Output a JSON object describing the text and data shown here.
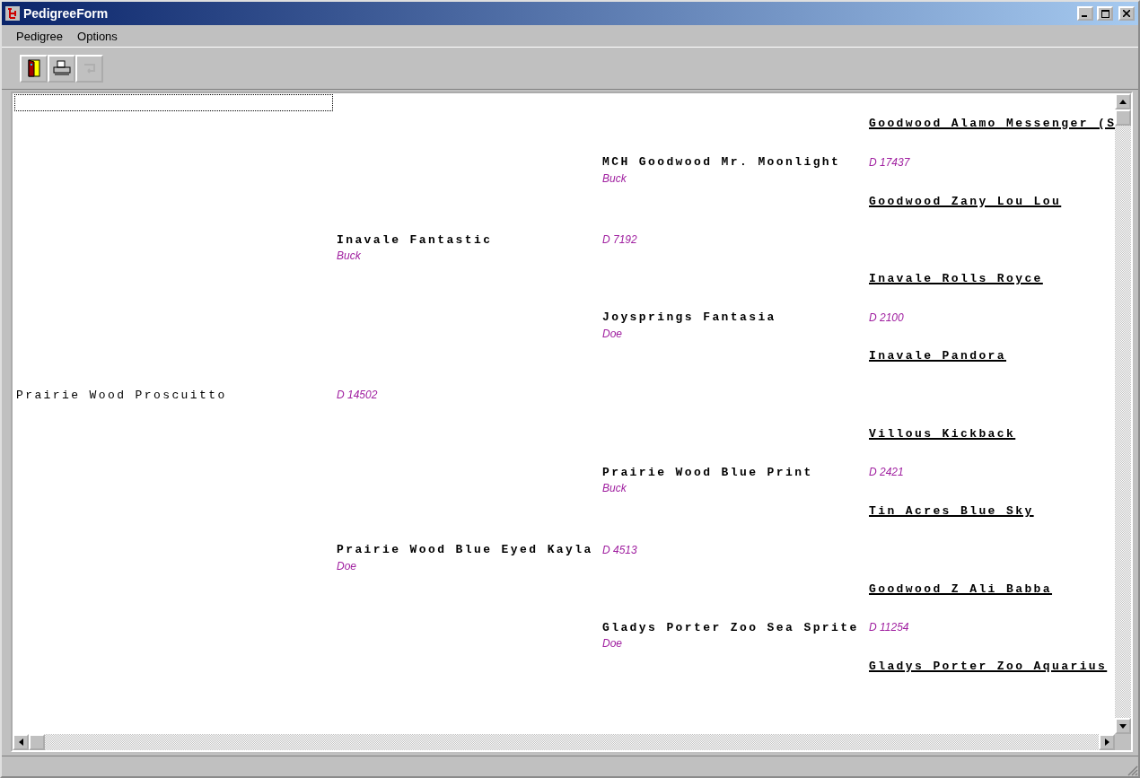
{
  "window": {
    "title": "PedigreeForm"
  },
  "menu": [
    "Pedigree",
    "Options"
  ],
  "toolbar": [
    {
      "kind": "door",
      "disabled": false
    },
    {
      "kind": "printer",
      "disabled": false
    },
    {
      "kind": "back",
      "disabled": true
    }
  ],
  "pedigree": {
    "name": "Prairie Wood Proscuitto",
    "reg": "D 14502",
    "children": [
      {
        "name": "Inavale Fantastic",
        "sex": "Buck",
        "reg": "D 7192",
        "children": [
          {
            "name": "MCH Goodwood Mr. Moonlight",
            "sex": "Buck",
            "reg": "D 17437",
            "children": [
              {
                "name": "Goodwood Alamo Messenger (S"
              },
              {
                "name": "Goodwood Zany Lou Lou"
              }
            ]
          },
          {
            "name": "Joysprings Fantasia",
            "sex": "Doe",
            "reg": "D 2100",
            "children": [
              {
                "name": "Inavale Rolls Royce"
              },
              {
                "name": "Inavale Pandora"
              }
            ]
          }
        ]
      },
      {
        "name": "Prairie Wood Blue Eyed Kayla",
        "sex": "Doe",
        "reg": "D 4513",
        "children": [
          {
            "name": "Prairie Wood Blue Print",
            "sex": "Buck",
            "reg": "D 2421",
            "children": [
              {
                "name": "Villous Kickback"
              },
              {
                "name": "Tin Acres Blue Sky"
              }
            ]
          },
          {
            "name": "Gladys Porter Zoo Sea Sprite",
            "sex": "Doe",
            "reg": "D 11254",
            "children": [
              {
                "name": "Goodwood Z Ali Babba"
              },
              {
                "name": "Gladys Porter Zoo Aquarius"
              }
            ]
          }
        ]
      }
    ]
  }
}
